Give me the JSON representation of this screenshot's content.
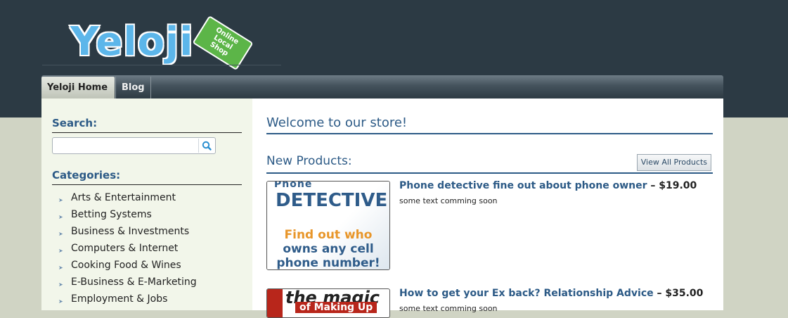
{
  "logo": {
    "word": "Yeloji",
    "tag_line1": "Online",
    "tag_line2": "Local",
    "tag_line3": "Shop"
  },
  "nav": {
    "tabs": [
      {
        "label": "Yeloji Home",
        "active": true
      },
      {
        "label": "Blog",
        "active": false
      }
    ]
  },
  "sidebar": {
    "search_heading": "Search:",
    "search_value": "",
    "categories_heading": "Categories:",
    "categories": [
      "Arts & Entertainment",
      "Betting Systems",
      "Business & Investments",
      "Computers & Internet",
      "Cooking Food & Wines",
      "E-Business & E-Marketing",
      "Employment & Jobs"
    ]
  },
  "main": {
    "title": "Welcome to our store!",
    "new_products_heading": "New Products:",
    "view_all_label": "View All Products",
    "products": [
      {
        "name": "Phone detective fine out about phone owner",
        "separator": " – ",
        "price": "$19.00",
        "description": "some text comming soon",
        "thumb": {
          "line_a": "Phone",
          "line_b": "DETECTIVE",
          "line_c": "Find out who",
          "line_d": "owns any cell",
          "line_e": "phone number!"
        }
      },
      {
        "name": "How to get your Ex back? Relationship Advice",
        "separator": " – ",
        "price": "$35.00",
        "description": "some text comming soon",
        "thumb": {
          "line_a": "the magic",
          "line_b": "of Making Up"
        }
      }
    ]
  },
  "colors": {
    "header_bg": "#2c3a44",
    "page_bg": "#d0d4c4",
    "sidebar_bg": "#f2f6ea",
    "heading_blue": "#2c5a86",
    "logo_blue": "#5cb6ea",
    "logo_green": "#5cb548"
  }
}
